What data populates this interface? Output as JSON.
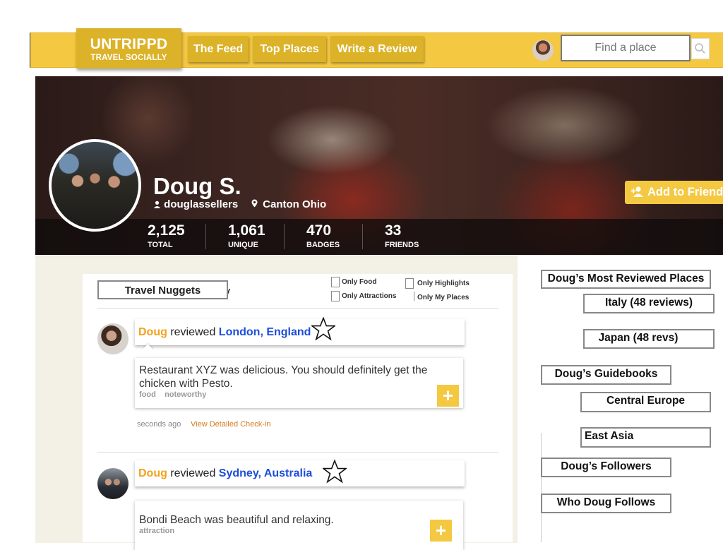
{
  "brand": {
    "name": "UNTRIPPD",
    "tagline": "TRAVEL SOCIALLY"
  },
  "nav": {
    "items": [
      "The Feed",
      "Top Places",
      "Write a Review"
    ]
  },
  "search": {
    "placeholder": "Find a place",
    "icon": "search-icon"
  },
  "profile": {
    "name": "Doug S.",
    "username": "douglassellers",
    "location": "Canton Ohio",
    "add_friend_label": "Add to Friend",
    "stats": [
      {
        "value": "2,125",
        "label": "TOTAL"
      },
      {
        "value": "1,061",
        "label": "UNIQUE"
      },
      {
        "value": "470",
        "label": "BADGES"
      },
      {
        "value": "33",
        "label": "FRIENDS"
      }
    ]
  },
  "feed": {
    "title": "Travel Nuggets",
    "filters": [
      "Only Food",
      "Only Attractions",
      "Only Highlights",
      "Only My Places"
    ],
    "items": [
      {
        "user": "Doug",
        "action": " reviewed ",
        "place": "London, England",
        "text": "Restaurant XYZ was delicious. You should definitely get the chicken with Pesto.",
        "tags": [
          "food",
          "noteworthy"
        ],
        "time": "seconds ago",
        "link": "View Detailed Check-in"
      },
      {
        "user": "Doug",
        "action": " reviewed ",
        "place": "Sydney, Australia",
        "text": "Bondi Beach was beautiful and relaxing.",
        "tags": [
          "attraction"
        ]
      }
    ]
  },
  "sidebar": {
    "most_reviewed_title": "Doug’s Most Reviewed Places",
    "most_reviewed": [
      "Italy (48 reviews)",
      "Japan (48 revs)"
    ],
    "guidebooks_title": "Doug’s Guidebooks",
    "guidebooks": [
      "Central Europe",
      "East Asia"
    ],
    "followers_label": "Doug’s Followers",
    "follows_label": "Who Doug Follows"
  },
  "colors": {
    "accent": "#f5c842",
    "accent_dark": "#dcb228",
    "user": "#f3a21e",
    "place": "#1d4ed8"
  }
}
